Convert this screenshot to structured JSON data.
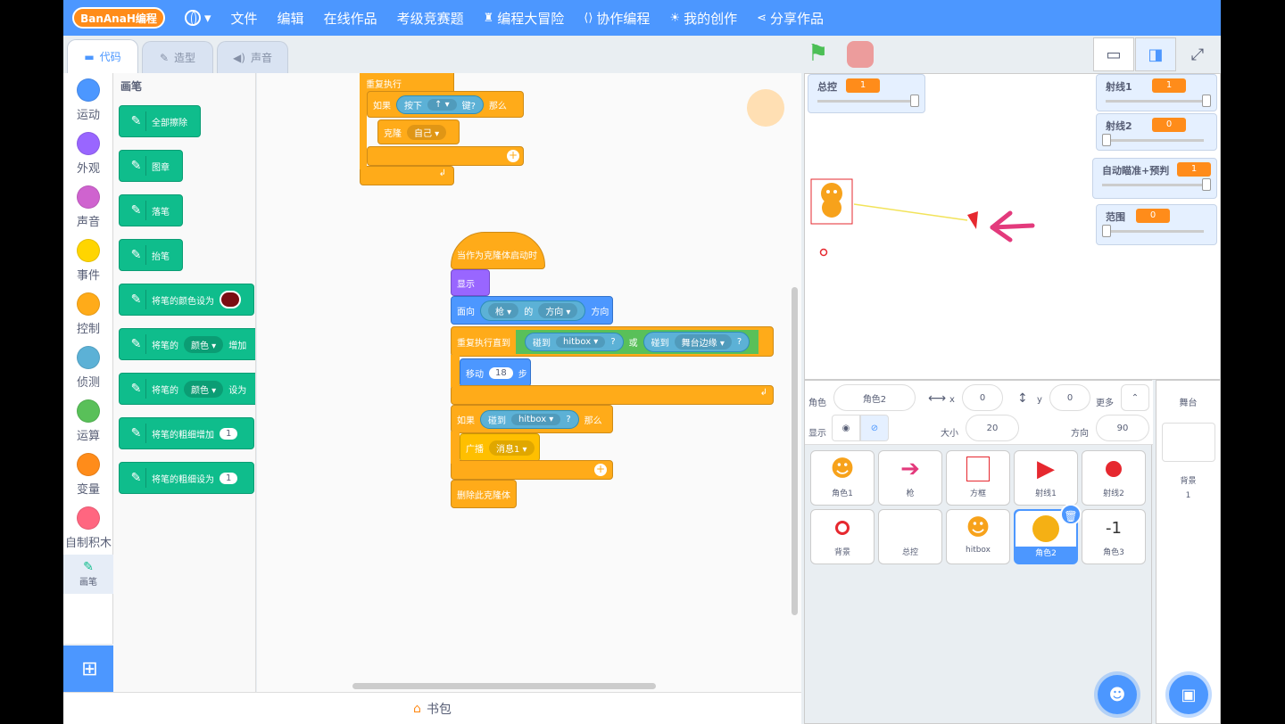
{
  "menubar": {
    "logo": "BanAnaH编程",
    "items": [
      "文件",
      "编辑",
      "在线作品",
      "考级竞赛题",
      "编程大冒险",
      "协作编程",
      "我的创作",
      "分享作品"
    ]
  },
  "tabs": {
    "code": "代码",
    "costumes": "造型",
    "sounds": "声音"
  },
  "categories": [
    {
      "label": "运动",
      "color": "#4c97ff"
    },
    {
      "label": "外观",
      "color": "#9966ff"
    },
    {
      "label": "声音",
      "color": "#cf63cf"
    },
    {
      "label": "事件",
      "color": "#ffd500"
    },
    {
      "label": "控制",
      "color": "#ffab19"
    },
    {
      "label": "侦测",
      "color": "#5cb1d6"
    },
    {
      "label": "运算",
      "color": "#59c059"
    },
    {
      "label": "变量",
      "color": "#ff8c1a"
    },
    {
      "label": "自制积木",
      "color": "#ff6680"
    },
    {
      "label": "画笔",
      "color": ""
    }
  ],
  "palette": {
    "title": "画笔",
    "blocks": [
      "全部擦除",
      "图章",
      "落笔",
      "抬笔",
      "将笔的颜色设为",
      "将笔的",
      "颜色",
      "增加",
      "将笔的",
      "颜色",
      "设为",
      "将笔的粗细增加",
      "1",
      "将笔的粗细设为",
      "1"
    ]
  },
  "script1": {
    "forever": "重复执行",
    "if": "如果",
    "keypress": "按下",
    "key": "↑",
    "pressed": "键?",
    "then": "那么",
    "clone": "克隆",
    "self": "自己"
  },
  "script2": {
    "hat": "当作为克隆体启动时",
    "show": "显示",
    "point": "面向",
    "gun": "枪",
    "of": "的",
    "dir": "方向",
    "dir2": "方向",
    "repeat_until": "重复执行直到",
    "touch1": "碰到",
    "hitbox": "hitbox",
    "q": "?",
    "or": "或",
    "touch2": "碰到",
    "edge": "舞台边缘",
    "q2": "?",
    "move": "移动",
    "steps_val": "18",
    "steps": "步",
    "if": "如果",
    "touch3": "碰到",
    "hitbox2": "hitbox",
    "q3": "?",
    "then": "那么",
    "broadcast": "广播",
    "msg": "消息1",
    "delete": "删除此克隆体"
  },
  "backpack": "书包",
  "monitors": [
    {
      "label": "总控",
      "value": "1"
    },
    {
      "label": "射线1",
      "value": "1"
    },
    {
      "label": "射线2",
      "value": "0"
    },
    {
      "label": "自动瞄准+预判",
      "value": "1"
    },
    {
      "label": "范围",
      "value": "0"
    }
  ],
  "sprite_info": {
    "sprite_label": "角色",
    "sprite_name": "角色2",
    "x_label": "x",
    "x": "0",
    "y_label": "y",
    "y": "0",
    "more": "更多",
    "show_label": "显示",
    "size_label": "大小",
    "size": "20",
    "dir_label": "方向",
    "dir": "90"
  },
  "sprites": [
    "角色1",
    "枪",
    "方框",
    "射线1",
    "射线2",
    "背景",
    "总控",
    "hitbox",
    "角色2",
    "角色3"
  ],
  "sprite_glyph_neg": "-1",
  "stage_panel": {
    "title": "舞台",
    "backdrop_label": "背景",
    "backdrop_count": "1"
  }
}
